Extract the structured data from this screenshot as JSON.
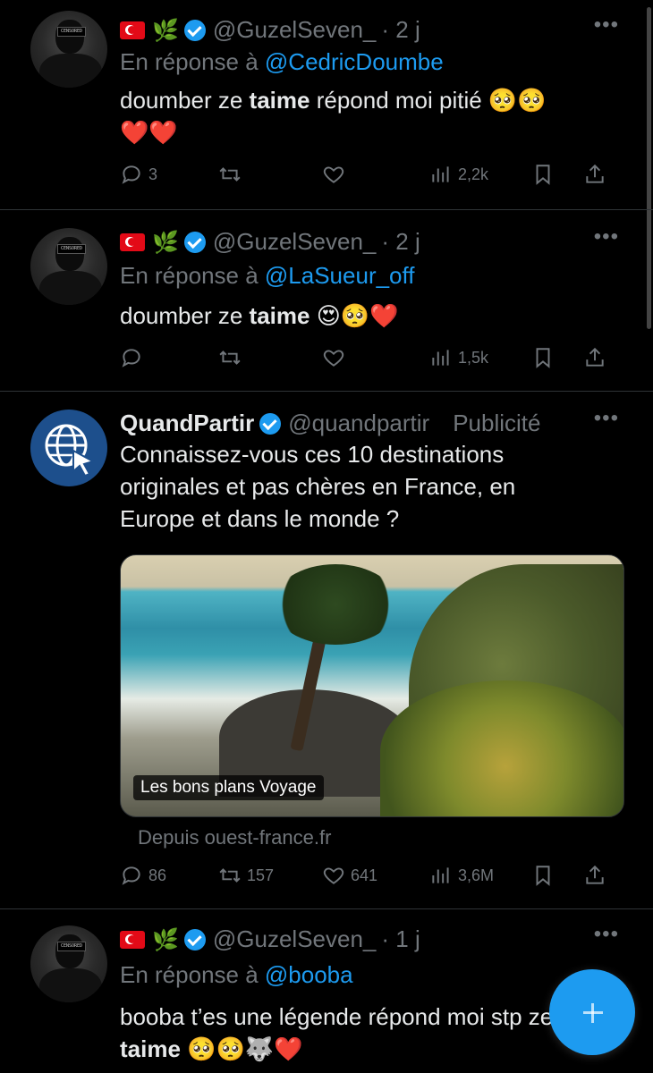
{
  "tweets": [
    {
      "handle": "@GuzelSeven_",
      "time": "· 2 j",
      "reply_prefix": "En réponse à",
      "reply_to": "@CedricDoumbe",
      "text_before": "doumber ze",
      "text_bold": "taime",
      "text_after": "répond moi pitié 🥺🥺",
      "text_line2": "❤️❤️",
      "replies": "3",
      "retweets": "",
      "likes": "",
      "views": "2,2k"
    },
    {
      "handle": "@GuzelSeven_",
      "time": "· 2 j",
      "reply_prefix": "En réponse à",
      "reply_to": "@LaSueur_off",
      "text_before": "doumber ze",
      "text_bold": "taime",
      "text_after": "😍🥺❤️",
      "replies": "",
      "retweets": "",
      "likes": "",
      "views": "1,5k"
    },
    {
      "name": "QuandPartir",
      "handle": "@quandpartir",
      "promoted": "Publicité",
      "text": "Connaissez-vous ces 10 destinations originales et pas chères en France, en Europe et dans le monde ?",
      "card_label": "Les bons plans Voyage",
      "source": "Depuis ouest-france.fr",
      "replies": "86",
      "retweets": "157",
      "likes": "641",
      "views": "3,6M"
    },
    {
      "handle": "@GuzelSeven_",
      "time": "· 1 j",
      "reply_prefix": "En réponse à",
      "reply_to": "@booba",
      "text_before": "booba t’es une légende répond moi stp ze",
      "text_bold": "taime",
      "text_after": "🥺🥺🐺❤️"
    }
  ],
  "icons": {
    "reply": "reply-icon",
    "retweet": "retweet-icon",
    "like": "heart-icon",
    "views": "views-icon",
    "bookmark": "bookmark-icon",
    "share": "share-icon",
    "compose": "compose-plus-icon"
  },
  "colors": {
    "accent": "#1d9bf0",
    "muted": "#71767b",
    "text": "#e7e9ea",
    "background": "#000000"
  }
}
